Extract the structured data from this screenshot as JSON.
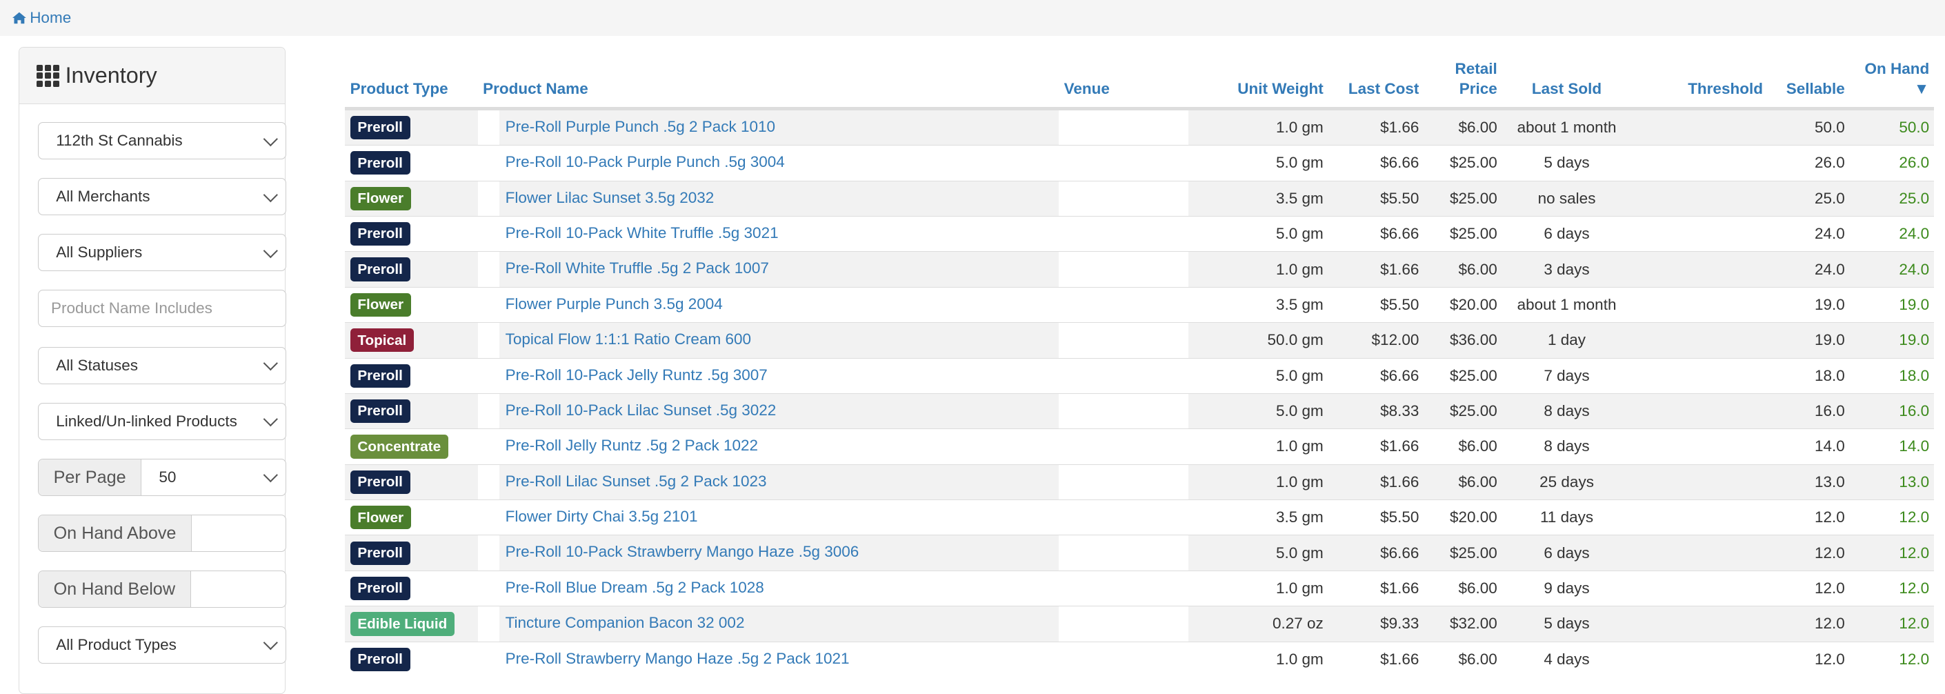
{
  "breadcrumb": {
    "home": "Home"
  },
  "sidebar": {
    "title": "Inventory",
    "location": "112th St Cannabis",
    "merchants": "All Merchants",
    "suppliers": "All Suppliers",
    "product_name_placeholder": "Product Name Includes",
    "statuses": "All Statuses",
    "linked": "Linked/Un-linked Products",
    "per_page_label": "Per Page",
    "per_page_value": "50",
    "on_hand_above_label": "On Hand Above",
    "on_hand_below_label": "On Hand Below",
    "product_types": "All Product Types"
  },
  "table": {
    "headers": {
      "type": "Product Type",
      "name": "Product Name",
      "venue": "Venue",
      "unit_weight": "Unit Weight",
      "last_cost": "Last Cost",
      "retail_price_1": "Retail",
      "retail_price_2": "Price",
      "last_sold": "Last Sold",
      "threshold": "Threshold",
      "sellable": "Sellable",
      "on_hand": "On Hand ▼"
    },
    "type_colors": {
      "Preroll": "#14264a",
      "Flower": "#4a7d2b",
      "Topical": "#8f2039",
      "Concentrate": "#6a8f3c",
      "Edible Liquid": "#4fae7b"
    },
    "rows": [
      {
        "type": "Preroll",
        "name": "Pre-Roll Purple Punch .5g 2 Pack 1010",
        "unit_weight": "1.0 gm",
        "last_cost": "$1.66",
        "retail": "$6.00",
        "last_sold": "about 1 month",
        "threshold": "",
        "sellable": "50.0",
        "on_hand": "50.0"
      },
      {
        "type": "Preroll",
        "name": "Pre-Roll 10-Pack Purple Punch .5g 3004",
        "unit_weight": "5.0 gm",
        "last_cost": "$6.66",
        "retail": "$25.00",
        "last_sold": "5 days",
        "threshold": "",
        "sellable": "26.0",
        "on_hand": "26.0"
      },
      {
        "type": "Flower",
        "name": "Flower Lilac Sunset 3.5g 2032",
        "unit_weight": "3.5 gm",
        "last_cost": "$5.50",
        "retail": "$25.00",
        "last_sold": "no sales",
        "threshold": "",
        "sellable": "25.0",
        "on_hand": "25.0"
      },
      {
        "type": "Preroll",
        "name": "Pre-Roll 10-Pack White Truffle .5g 3021",
        "unit_weight": "5.0 gm",
        "last_cost": "$6.66",
        "retail": "$25.00",
        "last_sold": "6 days",
        "threshold": "",
        "sellable": "24.0",
        "on_hand": "24.0"
      },
      {
        "type": "Preroll",
        "name": "Pre-Roll White Truffle .5g 2 Pack 1007",
        "unit_weight": "1.0 gm",
        "last_cost": "$1.66",
        "retail": "$6.00",
        "last_sold": "3 days",
        "threshold": "",
        "sellable": "24.0",
        "on_hand": "24.0"
      },
      {
        "type": "Flower",
        "name": "Flower Purple Punch 3.5g 2004",
        "unit_weight": "3.5 gm",
        "last_cost": "$5.50",
        "retail": "$20.00",
        "last_sold": "about 1 month",
        "threshold": "",
        "sellable": "19.0",
        "on_hand": "19.0"
      },
      {
        "type": "Topical",
        "name": "Topical Flow 1:1:1 Ratio Cream 600",
        "unit_weight": "50.0 gm",
        "last_cost": "$12.00",
        "retail": "$36.00",
        "last_sold": "1 day",
        "threshold": "",
        "sellable": "19.0",
        "on_hand": "19.0"
      },
      {
        "type": "Preroll",
        "name": "Pre-Roll 10-Pack Jelly Runtz .5g 3007",
        "unit_weight": "5.0 gm",
        "last_cost": "$6.66",
        "retail": "$25.00",
        "last_sold": "7 days",
        "threshold": "",
        "sellable": "18.0",
        "on_hand": "18.0"
      },
      {
        "type": "Preroll",
        "name": "Pre-Roll 10-Pack Lilac Sunset .5g 3022",
        "unit_weight": "5.0 gm",
        "last_cost": "$8.33",
        "retail": "$25.00",
        "last_sold": "8 days",
        "threshold": "",
        "sellable": "16.0",
        "on_hand": "16.0"
      },
      {
        "type": "Concentrate",
        "name": "Pre-Roll Jelly Runtz .5g 2 Pack 1022",
        "unit_weight": "1.0 gm",
        "last_cost": "$1.66",
        "retail": "$6.00",
        "last_sold": "8 days",
        "threshold": "",
        "sellable": "14.0",
        "on_hand": "14.0"
      },
      {
        "type": "Preroll",
        "name": "Pre-Roll Lilac Sunset .5g 2 Pack 1023",
        "unit_weight": "1.0 gm",
        "last_cost": "$1.66",
        "retail": "$6.00",
        "last_sold": "25 days",
        "threshold": "",
        "sellable": "13.0",
        "on_hand": "13.0"
      },
      {
        "type": "Flower",
        "name": "Flower Dirty Chai 3.5g 2101",
        "unit_weight": "3.5 gm",
        "last_cost": "$5.50",
        "retail": "$20.00",
        "last_sold": "11 days",
        "threshold": "",
        "sellable": "12.0",
        "on_hand": "12.0"
      },
      {
        "type": "Preroll",
        "name": "Pre-Roll 10-Pack Strawberry Mango Haze .5g 3006",
        "unit_weight": "5.0 gm",
        "last_cost": "$6.66",
        "retail": "$25.00",
        "last_sold": "6 days",
        "threshold": "",
        "sellable": "12.0",
        "on_hand": "12.0"
      },
      {
        "type": "Preroll",
        "name": "Pre-Roll Blue Dream .5g 2 Pack 1028",
        "unit_weight": "1.0 gm",
        "last_cost": "$1.66",
        "retail": "$6.00",
        "last_sold": "9 days",
        "threshold": "",
        "sellable": "12.0",
        "on_hand": "12.0"
      },
      {
        "type": "Edible Liquid",
        "name": "Tincture Companion Bacon 32 002",
        "unit_weight": "0.27 oz",
        "last_cost": "$9.33",
        "retail": "$32.00",
        "last_sold": "5 days",
        "threshold": "",
        "sellable": "12.0",
        "on_hand": "12.0"
      },
      {
        "type": "Preroll",
        "name": "Pre-Roll Strawberry Mango Haze .5g 2 Pack 1021",
        "unit_weight": "1.0 gm",
        "last_cost": "$1.66",
        "retail": "$6.00",
        "last_sold": "4 days",
        "threshold": "",
        "sellable": "12.0",
        "on_hand": "12.0"
      }
    ]
  }
}
